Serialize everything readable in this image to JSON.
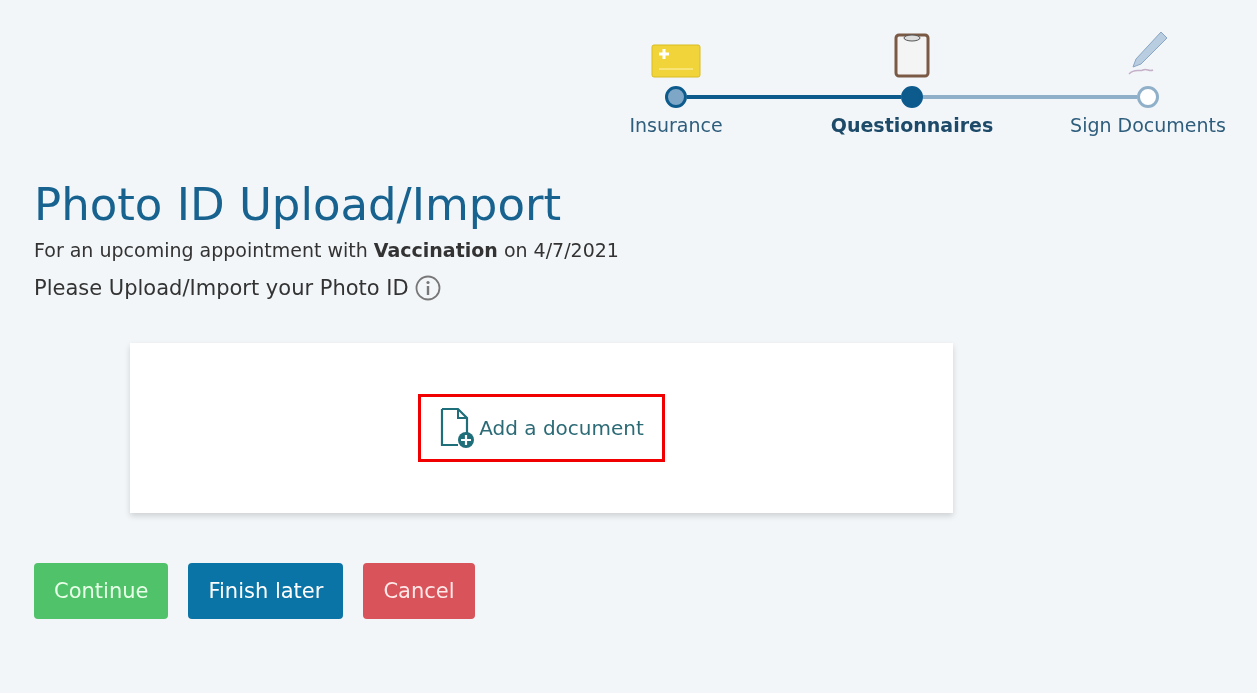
{
  "steps": [
    {
      "label": "Insurance",
      "completed": true,
      "selected": false
    },
    {
      "label": "Questionnaires",
      "completed": false,
      "selected": true
    },
    {
      "label": "Sign Documents",
      "completed": false,
      "selected": false
    }
  ],
  "title": "Photo ID Upload/Import",
  "subtitle": "For an upcoming appointment with **Vaccination** on 4/7/2021",
  "prompt": "Please Upload/Import your Photo ID",
  "upload": {
    "label": "Add a document",
    "highlighted": true
  },
  "buttons": [
    {
      "label": "Continue",
      "kind": "success"
    },
    {
      "label": "Finish later",
      "kind": "primary"
    },
    {
      "label": "Cancel",
      "kind": "danger"
    }
  ]
}
